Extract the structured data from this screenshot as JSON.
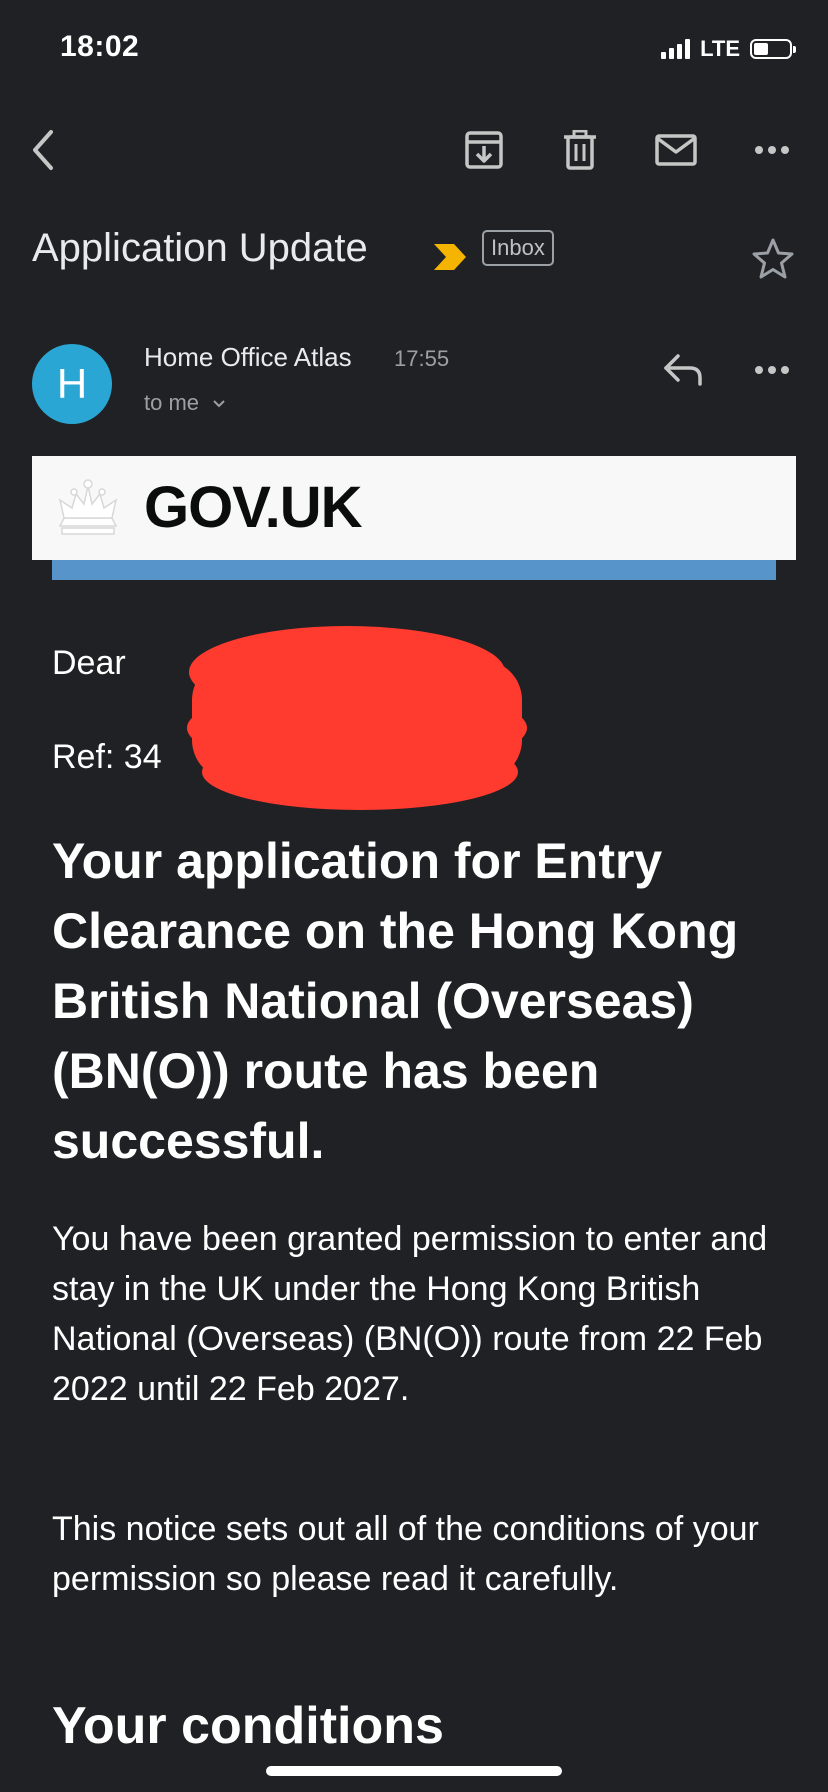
{
  "status_bar": {
    "time": "18:02",
    "network": "LTE",
    "signal_bars": 4,
    "battery_level": 0.4
  },
  "toolbar": {
    "icons": [
      "back-arrow-icon",
      "archive-icon",
      "trash-icon",
      "mark-unread-icon",
      "more-options-icon"
    ]
  },
  "subject": {
    "title": "Application Update",
    "label": "Inbox",
    "importance_color": "#f5b400"
  },
  "sender": {
    "avatar_letter": "H",
    "avatar_color": "#2aa6d5",
    "name": "Home Office Atlas",
    "time": "17:55",
    "recipient": "to me"
  },
  "banner": {
    "brand": "GOV.UK",
    "stripe_color": "#5694ca"
  },
  "body": {
    "greeting": "Dear",
    "ref": "Ref: 34",
    "headline": "Your application for Entry Clearance on the Hong Kong British National (Overseas) (BN(O)) route has been successful.",
    "paragraph1": "You have been granted permission to enter and stay in the UK under the Hong Kong British National (Overseas) (BN(O)) route from 22 Feb 2022 until 22 Feb 2027.",
    "paragraph2": "This notice sets out all of the conditions of your permission so please read it carefully.",
    "section_heading": "Your conditions"
  },
  "redaction_color": "#ff3b30"
}
